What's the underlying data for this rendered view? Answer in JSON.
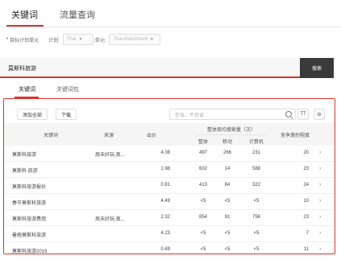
{
  "top_tabs": [
    "关键词",
    "流量查询"
  ],
  "filters": {
    "label": "目标计划单元",
    "plan_label": "计划:",
    "plan_value": "Thai",
    "unit_label": "单元:",
    "unit_value": "Thai investment"
  },
  "search": {
    "value": "莫斯科旅游",
    "button": "搜索"
  },
  "sub_tabs": [
    "关键词",
    "关键词包"
  ],
  "toolbar": {
    "add_all": "添加全部",
    "download": "下载",
    "filter_placeholder": "包含、不包含",
    "text_icon": "TT",
    "settings_icon": "⚙"
  },
  "table": {
    "headers": {
      "keyword": "关键词",
      "source": "来源",
      "bid": "出价",
      "weekly": "整体周均搜索量（次）",
      "overall": "整体",
      "mobile": "移动",
      "pc": "计算机",
      "competition": "竞争激烈程度"
    },
    "rows": [
      {
        "keyword": "莫斯科旅游",
        "source": "周末好玩,夜...",
        "bid": "4.08",
        "overall": "497",
        "mobile": "266",
        "pc": "231",
        "comp": "20"
      },
      {
        "keyword": "莫斯科 旅游",
        "source": "",
        "bid": "1.98",
        "overall": "602",
        "mobile": "14",
        "pc": "588",
        "comp": "23"
      },
      {
        "keyword": "莫斯科旅游报价",
        "source": "",
        "bid": "0.81",
        "overall": "413",
        "mobile": "84",
        "pc": "322",
        "comp": "24"
      },
      {
        "keyword": "春节莫斯科旅游",
        "source": "",
        "bid": "4.49",
        "overall": "<5",
        "mobile": "<5",
        "pc": "<5",
        "comp": "10"
      },
      {
        "keyword": "莫斯科旅游费用",
        "source": "周末好玩,夜...",
        "bid": "2.32",
        "overall": "854",
        "mobile": "91",
        "pc": "756",
        "comp": "23"
      },
      {
        "keyword": "暑假莫斯科旅游",
        "source": "",
        "bid": "4.23",
        "overall": "<5",
        "mobile": "<5",
        "pc": "<5",
        "comp": "7"
      },
      {
        "keyword": "莫斯科旅游2019",
        "source": "",
        "bid": "0.49",
        "overall": "<5",
        "mobile": "<5",
        "pc": "<5",
        "comp": "11"
      }
    ]
  }
}
